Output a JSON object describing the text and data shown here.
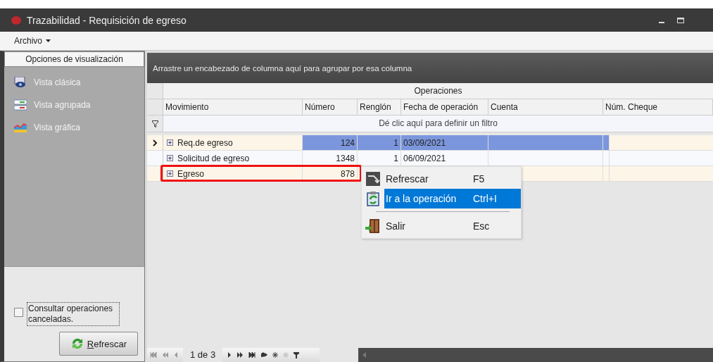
{
  "window": {
    "title": "Trazabilidad - Requisición de egreso"
  },
  "menu": [
    {
      "label": "Archivo"
    }
  ],
  "sidebar": {
    "title": "Opciones de visualización",
    "items": [
      {
        "label": "Vista clásica",
        "kind": "classic"
      },
      {
        "label": "Vista agrupada",
        "kind": "grouped"
      },
      {
        "label": "Vista gráfica",
        "kind": "chart"
      }
    ],
    "checkbox": {
      "label": "Consultar operaciones canceladas.",
      "checked": false
    },
    "refresh_button": {
      "label": "Refrescar"
    }
  },
  "grid": {
    "group_hint": "Arrastre un encabezado de columna aquí para agrupar por esa columna",
    "band": "Operaciones",
    "columns": [
      "Movimiento",
      "Número",
      "Renglón",
      "Fecha de operación",
      "Cuenta",
      "Núm. Cheque"
    ],
    "filter_hint": "Dé clic aquí para definir un filtro",
    "rows": [
      {
        "cells": [
          "Req.de egreso",
          "124",
          "1",
          "03/09/2021",
          "",
          ""
        ],
        "selected": true,
        "highlighted": false
      },
      {
        "cells": [
          "Solicitud de egreso",
          "1348",
          "1",
          "06/09/2021",
          "",
          ""
        ],
        "selected": false,
        "highlighted": false
      },
      {
        "cells": [
          "Egreso",
          "878",
          "",
          "",
          "",
          ""
        ],
        "selected": false,
        "highlighted": true
      }
    ],
    "context_menu": [
      {
        "kind": "item",
        "label": "Refrescar",
        "shortcut": "F5",
        "selected": false
      },
      {
        "kind": "item",
        "label": "Ir a la operación",
        "shortcut": "Ctrl+I",
        "selected": true
      },
      {
        "kind": "separator"
      },
      {
        "kind": "item",
        "label": "Salir",
        "shortcut": "Esc",
        "selected": false
      }
    ],
    "pager": {
      "page_text": "1 de 3"
    }
  }
}
